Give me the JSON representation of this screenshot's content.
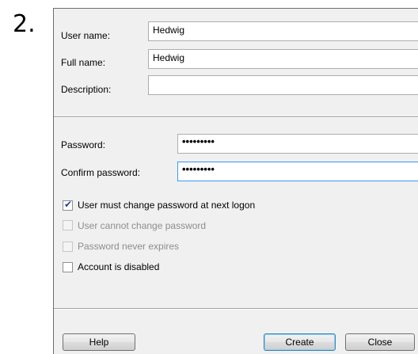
{
  "step_number": "2.",
  "form": {
    "user_name_label": "User name:",
    "user_name_value": "Hedwig",
    "full_name_label": "Full name:",
    "full_name_value": "Hedwig",
    "description_label": "Description:",
    "description_value": "",
    "password_label": "Password:",
    "password_value": "•••••••••",
    "confirm_password_label": "Confirm password:",
    "confirm_password_value": "•••••••••"
  },
  "options": [
    {
      "label": "User must change password at next logon",
      "checked": true,
      "enabled": true
    },
    {
      "label": "User cannot change password",
      "checked": false,
      "enabled": false
    },
    {
      "label": "Password never expires",
      "checked": false,
      "enabled": false
    },
    {
      "label": "Account is disabled",
      "checked": false,
      "enabled": true
    }
  ],
  "buttons": {
    "help": "Help",
    "create": "Create",
    "close": "Close"
  },
  "colors": {
    "dialog_bg": "#f0f0f0",
    "focus_border": "#3399ff",
    "disabled_text": "#8d8d8d"
  }
}
